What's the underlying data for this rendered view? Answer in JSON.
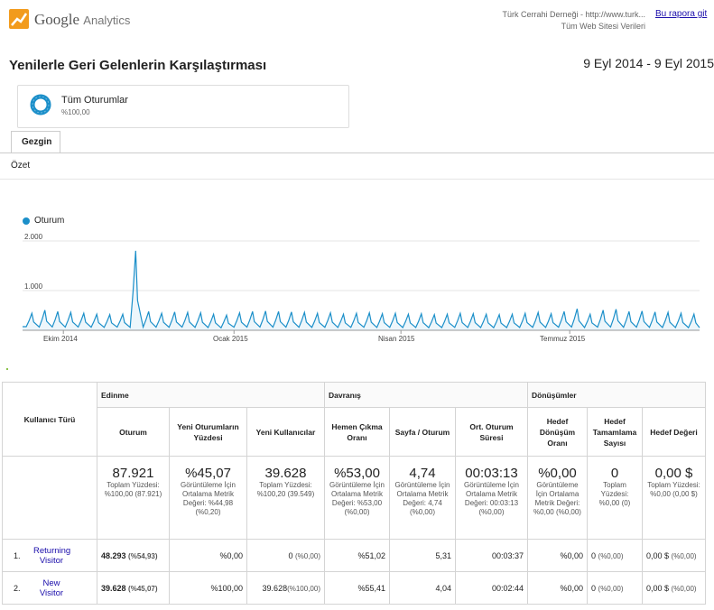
{
  "header": {
    "logo_brand": "Google",
    "logo_product": "Analytics",
    "site_line1": "Türk Cerrahi Derneği - http://www.turk...",
    "site_line2": "Tüm Web Sitesi Verileri",
    "report_link": "Bu rapora git"
  },
  "report": {
    "title": "Yenilerle Geri Gelenlerin Karşılaştırması",
    "date_range": "9 Eyl 2014 - 9 Eyl 2015"
  },
  "segment": {
    "label": "Tüm Oturumlar",
    "percent": "%100,00"
  },
  "tabs": {
    "explorer": "Gezgin",
    "summary": "Özet"
  },
  "colors": {
    "line": "#1b8fc9",
    "accent_orange": "#f29b1d",
    "link": "#1a0dab"
  },
  "chart_data": {
    "type": "line",
    "series": [
      {
        "name": "Oturum"
      }
    ],
    "yticks": [
      "2.000",
      "1.000"
    ],
    "xticks": [
      "Ekim 2014",
      "Ocak 2015",
      "Nisan 2015",
      "Temmuz 2015"
    ],
    "ylim": [
      0,
      2000
    ],
    "x": [
      "2014-09-09",
      "2015-09-09"
    ],
    "weekly_peak_dates": [
      "2014-09-14",
      "2014-09-21",
      "2014-09-28",
      "2014-10-05",
      "2014-10-12",
      "2014-10-19",
      "2014-10-26",
      "2014-11-02",
      "2014-11-09",
      "2014-11-16",
      "2014-11-23",
      "2014-11-30",
      "2014-12-07",
      "2014-12-14",
      "2014-12-21",
      "2014-12-28",
      "2015-01-04",
      "2015-01-11",
      "2015-01-18",
      "2015-01-25",
      "2015-02-01",
      "2015-02-08",
      "2015-02-15",
      "2015-02-22",
      "2015-03-01",
      "2015-03-08",
      "2015-03-15",
      "2015-03-22",
      "2015-03-29",
      "2015-04-05",
      "2015-04-12",
      "2015-04-19",
      "2015-04-26",
      "2015-05-03",
      "2015-05-10",
      "2015-05-17",
      "2015-05-24",
      "2015-05-31",
      "2015-06-07",
      "2015-06-14",
      "2015-06-21",
      "2015-06-28",
      "2015-07-05",
      "2015-07-12",
      "2015-07-19",
      "2015-07-26",
      "2015-08-02",
      "2015-08-09",
      "2015-08-16",
      "2015-08-23",
      "2015-08-30",
      "2015-09-06"
    ],
    "weekly_peak_values": [
      380,
      450,
      420,
      400,
      380,
      360,
      350,
      360,
      1780,
      420,
      380,
      410,
      400,
      390,
      360,
      340,
      390,
      420,
      430,
      420,
      410,
      400,
      380,
      390,
      360,
      380,
      390,
      370,
      380,
      360,
      370,
      350,
      360,
      380,
      370,
      360,
      350,
      360,
      380,
      400,
      370,
      420,
      480,
      360,
      450,
      470,
      420,
      430,
      410,
      400,
      380,
      360
    ],
    "weekly_low_values": [
      80,
      70,
      75,
      70,
      72,
      68,
      65,
      70,
      65,
      70,
      68,
      66,
      70,
      65,
      60,
      55,
      68,
      70,
      72,
      70,
      68,
      66,
      64,
      66,
      62,
      64,
      66,
      63,
      64,
      60,
      62,
      58,
      60,
      64,
      62,
      60,
      58,
      60,
      62,
      66,
      62,
      68,
      72,
      60,
      70,
      72,
      66,
      68,
      64,
      62,
      60,
      58
    ]
  },
  "table": {
    "groups": {
      "acquisition": "Edinme",
      "behavior": "Davranış",
      "conversions": "Dönüşümler"
    },
    "dimension_header": "Kullanıcı Türü",
    "columns": [
      "Oturum",
      "Yeni Oturumların Yüzdesi",
      "Yeni Kullanıcılar",
      "Hemen Çıkma Oranı",
      "Sayfa / Oturum",
      "Ort. Oturum Süresi",
      "Hedef Dönüşüm Oranı",
      "Hedef Tamamlama Sayısı",
      "Hedef Değeri"
    ],
    "totals": [
      {
        "value": "87.921",
        "note": "Toplam Yüzdesi: %100,00 (87.921)"
      },
      {
        "value": "%45,07",
        "note": "Görüntüleme İçin Ortalama Metrik Değeri: %44,98 (%0,20)"
      },
      {
        "value": "39.628",
        "note": "Toplam Yüzdesi: %100,20 (39.549)"
      },
      {
        "value": "%53,00",
        "note": "Görüntüleme İçin Ortalama Metrik Değeri: %53,00 (%0,00)"
      },
      {
        "value": "4,74",
        "note": "Görüntüleme İçin Ortalama Metrik Değeri: 4,74 (%0,00)"
      },
      {
        "value": "00:03:13",
        "note": "Görüntüleme İçin Ortalama Metrik Değeri: 00:03:13 (%0,00)"
      },
      {
        "value": "%0,00",
        "note": "Görüntüleme İçin Ortalama Metrik Değeri: %0,00 (%0,00)"
      },
      {
        "value": "0",
        "note": "Toplam Yüzdesi: %0,00 (0)"
      },
      {
        "value": "0,00 $",
        "note": "Toplam Yüzdesi: %0,00 (0,00 $)"
      }
    ],
    "rows": [
      {
        "index": "1.",
        "name": "Returning Visitor",
        "sessions": "48.293",
        "sessions_pct": "(%54,93)",
        "new_sessions_pct": "%0,00",
        "new_users": "0",
        "new_users_pct": "(%0,00)",
        "bounce": "%51,02",
        "pages": "5,31",
        "duration": "00:03:37",
        "goal_rate": "%0,00",
        "goal_count": "0",
        "goal_count_pct": "(%0,00)",
        "goal_value": "0,00 $",
        "goal_value_pct": "(%0,00)"
      },
      {
        "index": "2.",
        "name": "New Visitor",
        "sessions": "39.628",
        "sessions_pct": "(%45,07)",
        "new_sessions_pct": "%100,00",
        "new_users": "39.628",
        "new_users_pct": "(%100,00)",
        "bounce": "%55,41",
        "pages": "4,04",
        "duration": "00:02:44",
        "goal_rate": "%0,00",
        "goal_count": "0",
        "goal_count_pct": "(%0,00)",
        "goal_value": "0,00 $",
        "goal_value_pct": "(%0,00)"
      }
    ]
  }
}
